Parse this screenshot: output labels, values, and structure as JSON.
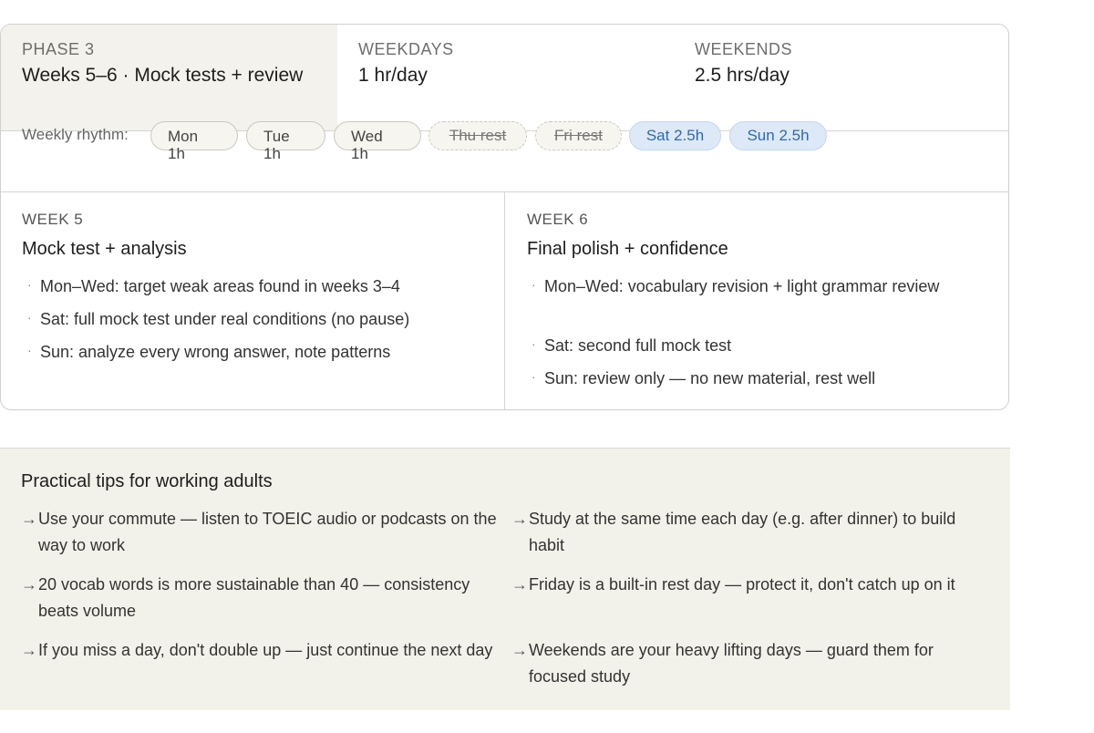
{
  "phase": {
    "label": "PHASE 3",
    "title": "Weeks 5–6 · Mock tests + review"
  },
  "weekdays": {
    "label": "WEEKDAYS",
    "value": "1 hr/day"
  },
  "weekends": {
    "label": "WEEKENDS",
    "value": "2.5 hrs/day"
  },
  "rhythm": {
    "label": "Weekly rhythm:",
    "days": [
      {
        "day": "Mon",
        "hours": "1h"
      },
      {
        "day": "Tue",
        "hours": "1h"
      },
      {
        "day": "Wed",
        "hours": "1h"
      },
      {
        "label": "Thu rest"
      },
      {
        "label": "Fri rest"
      },
      {
        "label": "Sat 2.5h"
      },
      {
        "label": "Sun 2.5h"
      }
    ]
  },
  "weeks": [
    {
      "label": "WEEK 5",
      "title": "Mock test + analysis",
      "items": [
        "Mon–Wed: target weak areas found in weeks 3–4",
        "Sat: full mock test under real conditions (no pause)",
        "Sun: analyze every wrong answer, note patterns"
      ]
    },
    {
      "label": "WEEK 6",
      "title": "Final polish + confidence",
      "items": [
        "Mon–Wed: vocabulary revision + light grammar review",
        "Sat: second full mock test",
        "Sun: review only — no new material, rest well"
      ]
    }
  ],
  "tips": {
    "title": "Practical tips for working adults",
    "arrow": "→",
    "items": [
      "Use your commute — listen to TOEIC audio or podcasts on the way to work",
      "Study at the same time each day (e.g. after dinner) to build habit",
      "20 vocab words is more sustainable than 40 — consistency beats volume",
      "Friday is a built-in rest day — protect it, don't catch up on it",
      "If you miss a day, don't double up — just continue the next day",
      "Weekends are your heavy lifting days — guard them for focused study"
    ]
  },
  "colors": {
    "phase_bg": "#f3f2ec",
    "weekend_pill_bg": "#dde9f7",
    "weekend_pill_text": "#2f6bb0",
    "tips_bg": "#f3f2ea"
  }
}
